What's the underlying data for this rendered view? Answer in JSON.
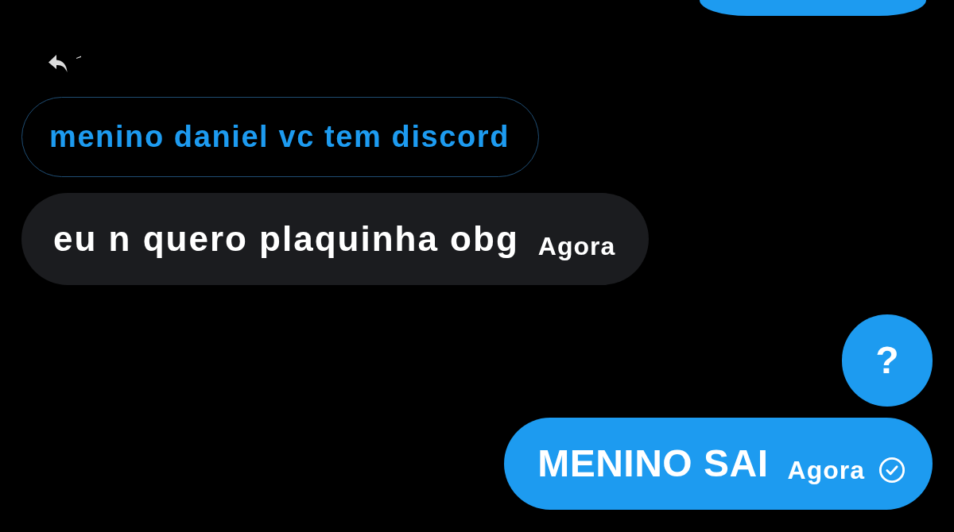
{
  "messages": [
    {
      "kind": "partial",
      "outgoing": true
    },
    {
      "kind": "text",
      "outgoing": false,
      "reply_to": "menino daniel vc tem discord",
      "text": "eu n quero plaquinha obg",
      "time": "Agora"
    },
    {
      "kind": "text",
      "outgoing": true,
      "text": "?"
    },
    {
      "kind": "text",
      "outgoing": true,
      "text": "MENINO SAI",
      "time": "Agora",
      "seen": true
    }
  ]
}
